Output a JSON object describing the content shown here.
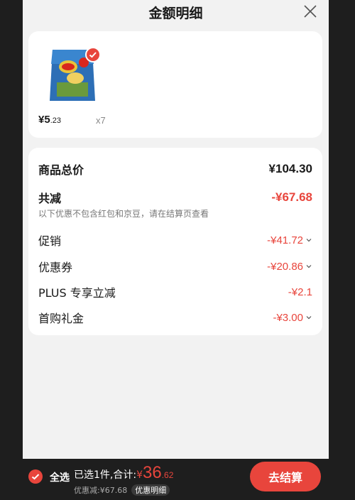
{
  "header": {
    "title": "金额明细"
  },
  "product": {
    "price_yen": "¥",
    "price_int": "5",
    "price_dec": ".23",
    "quantity": "x7"
  },
  "detail": {
    "total_label": "商品总价",
    "total_value": "¥104.30",
    "reduce_label": "共减",
    "reduce_value": "-¥67.68",
    "note": "以下优惠不包含红包和京豆，请在结算页查看",
    "items": [
      {
        "label": "促销",
        "value": "-¥41.72"
      },
      {
        "label": "优惠券",
        "value": "-¥20.86"
      },
      {
        "label": "PLUS 专享立减",
        "value": "-¥2.1"
      },
      {
        "label": "首购礼金",
        "value": "-¥3.00"
      }
    ]
  },
  "footer": {
    "select_all": "全选",
    "summary_prefix": "已选1件,合计:",
    "amount_yen": "¥",
    "amount_int": "36",
    "amount_dec": ".62",
    "discount_text": "优惠减:¥67.68",
    "discount_tag": "优惠明细",
    "checkout": "去结算"
  },
  "colors": {
    "accent": "#e8453c",
    "background": "#1e1e1e",
    "sheet": "#f2f2f2"
  }
}
